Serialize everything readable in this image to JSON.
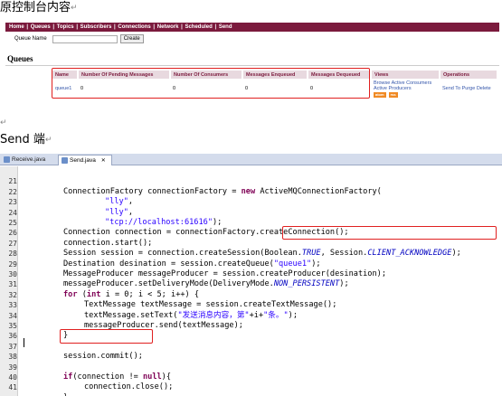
{
  "headings": {
    "console": "原控制台内容",
    "send": "Send 端",
    "para_mark": "↵"
  },
  "nav": {
    "items": [
      "Home",
      "Queues",
      "Topics",
      "Subscribers",
      "Connections",
      "Network",
      "Scheduled",
      "Send"
    ],
    "separator": "|"
  },
  "queue_form": {
    "label": "Queue Name",
    "input_value": "",
    "button": "Create"
  },
  "queues_title": "Queues",
  "table": {
    "columns": [
      "Name",
      "Number Of Pending Messages",
      "Number Of Consumers",
      "Messages Enqueued",
      "Messages Dequeued",
      "Views",
      "Operations"
    ],
    "row": {
      "name": "queue1",
      "pending": "0",
      "consumers": "0",
      "enqueued": "0",
      "dequeued": "0",
      "views_consumers": "Browse Active Consumers",
      "views_producers": "Active Producers",
      "atom": "atom",
      "rss": "rss",
      "operations": "Send To Purge Delete"
    }
  },
  "tabs": {
    "receive": "Receive.java",
    "send": "Send.java",
    "close": "✕"
  },
  "code": {
    "l21": "ConnectionFactory connectionFactory = new ActiveMQConnectionFactory(",
    "l22": "    \"lly\",",
    "l23": "    \"lly\",",
    "l24": "    \"tcp://localhost:61616\");",
    "l25": "Connection connection = connectionFactory.createConnection();",
    "l26": "connection.start();",
    "l27": "Session session = connection.createSession(Boolean.TRUE, Session.CLIENT_ACKNOWLEDGE);",
    "l28": "Destination desination = session.createQueue(\"queue1\");",
    "l29": "MessageProducer messageProducer = session.createProducer(desination);",
    "l30": "messageProducer.setDeliveryMode(DeliveryMode.NON_PERSISTENT);",
    "l31": "for (int i = 0; i < 5; i++) {",
    "l32": "    TextMessage textMessage = session.createTextMessage();",
    "l33": "    textMessage.setText(\"发送消息内容，第\"+i+\"条。\");",
    "l34": "    messageProducer.send(textMessage);",
    "l35": "}",
    "l36": "",
    "l37": "session.commit();",
    "l38": "",
    "l39": "if(connection != null){",
    "l40": "    connection.close();",
    "l41": "}"
  },
  "line_numbers": [
    "21",
    "22",
    "23",
    "24",
    "25",
    "26",
    "27",
    "28",
    "29",
    "30",
    "31",
    "32",
    "33",
    "34",
    "35",
    "36",
    "37",
    "38",
    "39",
    "40",
    "41"
  ],
  "colors": {
    "nav_bg": "#7b1a3d",
    "highlight_box": "#e02020",
    "keyword": "#7f0055",
    "string": "#2a00ff",
    "field": "#0000c0"
  }
}
